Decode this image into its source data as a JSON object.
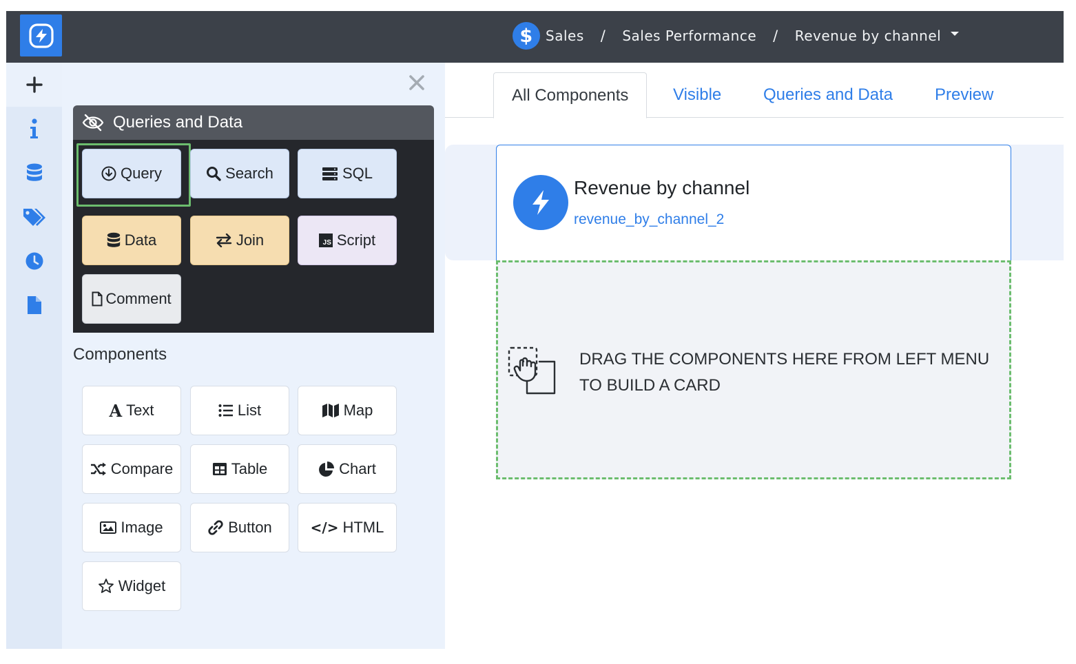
{
  "colors": {
    "accent": "#2f7ee8",
    "topbar": "#3c4149",
    "highlight": "#6cbd6e",
    "query_blue": "#dde8f8",
    "data_amber": "#f6ddb0",
    "script_lilac": "#ece7f5"
  },
  "topbar": {
    "logo_icon": "bolt-circle-icon",
    "breadcrumb": [
      {
        "icon": "dollar-icon",
        "glyph": "$",
        "label": "Sales"
      },
      {
        "label": "Sales Performance"
      },
      {
        "label": "Revenue by channel"
      }
    ],
    "separator": "/"
  },
  "rail": {
    "items": [
      "plus-icon",
      "info-icon",
      "database-icon",
      "tags-icon",
      "clock-icon",
      "file-icon"
    ]
  },
  "panel": {
    "close_icon": "close-icon",
    "queries_section": {
      "title": "Queries and Data",
      "title_icon": "eye-slash-icon",
      "tiles": [
        {
          "label": "Query",
          "icon": "circle-arrow-down-icon",
          "style": "blue",
          "highlighted": true
        },
        {
          "label": "Search",
          "icon": "search-icon",
          "style": "blue"
        },
        {
          "label": "SQL",
          "icon": "server-icon",
          "style": "blue"
        },
        {
          "label": "Data",
          "icon": "database-icon",
          "style": "amber"
        },
        {
          "label": "Join",
          "icon": "exchange-icon",
          "style": "amber"
        },
        {
          "label": "Script",
          "icon": "js-icon",
          "icon_text": "JS",
          "style": "lilac"
        },
        {
          "label": "Comment",
          "icon": "file-outline-icon",
          "style": "grey"
        }
      ]
    },
    "components_section": {
      "title": "Components",
      "tiles": [
        {
          "label": "Text",
          "icon": "font-icon",
          "icon_text": "A"
        },
        {
          "label": "List",
          "icon": "list-icon"
        },
        {
          "label": "Map",
          "icon": "map-icon"
        },
        {
          "label": "Compare",
          "icon": "random-icon"
        },
        {
          "label": "Table",
          "icon": "table-icon"
        },
        {
          "label": "Chart",
          "icon": "pie-chart-icon"
        },
        {
          "label": "Image",
          "icon": "image-icon"
        },
        {
          "label": "Button",
          "icon": "link-icon"
        },
        {
          "label": "HTML",
          "icon": "code-icon",
          "icon_text": "</>"
        },
        {
          "label": "Widget",
          "icon": "star-outline-icon"
        }
      ]
    }
  },
  "tabs": [
    {
      "label": "All Components",
      "active": true
    },
    {
      "label": "Visible",
      "active": false
    },
    {
      "label": "Queries and Data",
      "active": false
    },
    {
      "label": "Preview",
      "active": false
    }
  ],
  "card": {
    "icon": "bolt-icon",
    "title": "Revenue by channel",
    "subtitle": "revenue_by_channel_2"
  },
  "dropzone": {
    "icon": "drag-hand-icon",
    "message": "DRAG THE COMPONENTS HERE FROM LEFT MENU TO BUILD A CARD"
  }
}
